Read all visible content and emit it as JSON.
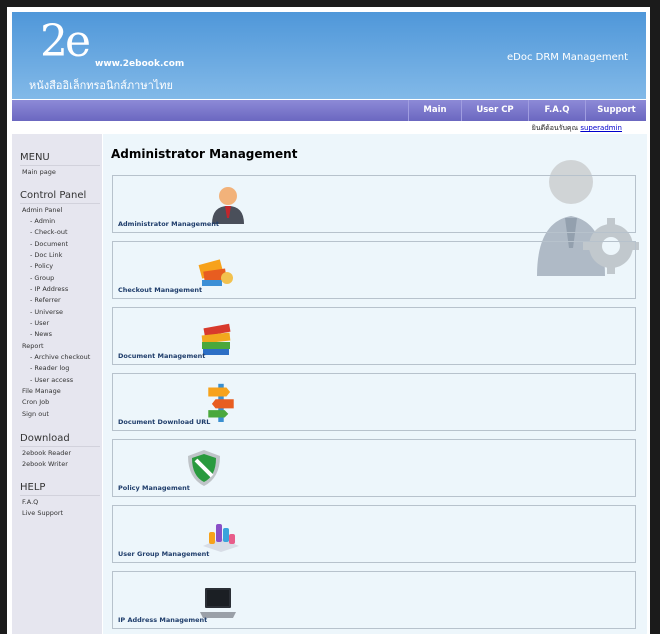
{
  "header": {
    "logo_mark": "2e",
    "logo_url": "www.2ebook.com",
    "logo_thai": "หนังสืออิเล็กทรอนิกส์ภาษาไทย",
    "title": "eDoc DRM Management"
  },
  "nav": {
    "items": [
      {
        "label": "Main"
      },
      {
        "label": "User CP"
      },
      {
        "label": "F.A.Q"
      },
      {
        "label": "Support"
      }
    ]
  },
  "welcome": {
    "prefix": "ยินดีต้อนรับคุณ",
    "user": "superadmin"
  },
  "sidebar": {
    "menu_heading": "MENU",
    "main_page": "Main page",
    "control_panel_heading": "Control Panel",
    "admin_panel": "Admin Panel",
    "admin_items": [
      "- Admin",
      "- Check-out",
      "- Document",
      "- Doc Link",
      "- Policy",
      "- Group",
      "- IP Address",
      "- Referrer",
      "- Universe",
      "- User",
      "- News"
    ],
    "report": "Report",
    "report_items": [
      "- Archive checkout",
      "- Reader log",
      "- User access"
    ],
    "file_manage": "File Manage",
    "cron_job": "Cron Job",
    "sign_out": "Sign out",
    "download_heading": "Download",
    "download_items": [
      "2ebook Reader",
      "2ebook Writer"
    ],
    "help_heading": "HELP",
    "help_items": [
      "F.A.Q",
      "Live Support"
    ]
  },
  "main": {
    "title": "Administrator Management",
    "cards": [
      {
        "label": "Administrator Management",
        "icon": "admin-person-icon"
      },
      {
        "label": "Checkout Management",
        "icon": "checkout-books-icon"
      },
      {
        "label": "Document Management",
        "icon": "document-books-icon"
      },
      {
        "label": "Document Download URL",
        "icon": "signpost-arrows-icon"
      },
      {
        "label": "Policy Management",
        "icon": "shield-icon"
      },
      {
        "label": "User Group Management",
        "icon": "user-group-icon"
      },
      {
        "label": "IP Address Management",
        "icon": "laptop-icon"
      }
    ]
  },
  "colors": {
    "header_top": "#4f97d9",
    "header_bottom": "#82b9e8",
    "nav": "#7a77cc",
    "sidebar_bg": "#e6e6ef",
    "main_bg": "#edf6fb",
    "card_label": "#1f3d6b"
  }
}
